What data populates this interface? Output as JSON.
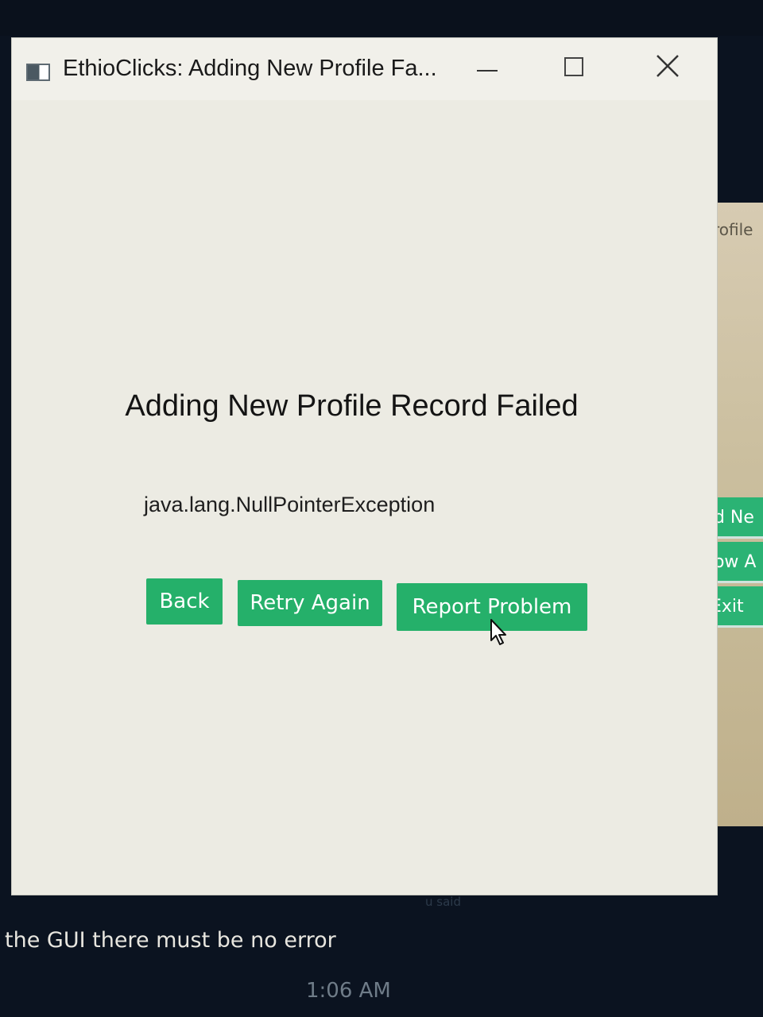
{
  "window": {
    "title": "EthioClicks: Adding New Profile Fa..."
  },
  "dialog": {
    "heading": "Adding New Profile Record Failed",
    "detail": "java.lang.NullPointerException",
    "buttons": {
      "back": "Back",
      "retry": "Retry Again",
      "report": "Report Problem"
    }
  },
  "background_window": {
    "tab_label": "rofile",
    "buttons": [
      "dd Ne",
      "how A",
      "Exit"
    ]
  },
  "chat": {
    "faint_label": "u said",
    "message": "the GUI there must be no error",
    "time": "1:06 AM"
  },
  "colors": {
    "button_green": "#25b06a",
    "dialog_bg": "#ecebe3",
    "screen_bg": "#0b1320"
  },
  "icons": {
    "app": "app-window-icon",
    "minimize": "minimize-icon",
    "maximize": "maximize-icon",
    "close": "close-icon",
    "cursor": "mouse-pointer-icon"
  }
}
